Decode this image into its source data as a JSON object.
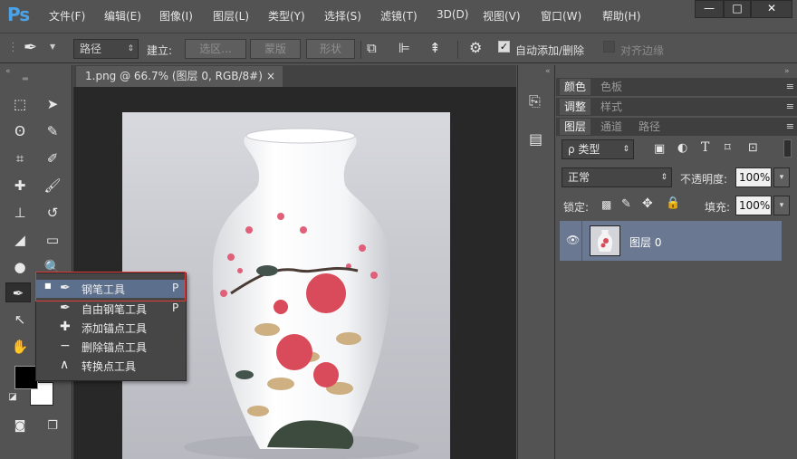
{
  "app": {
    "logo": "Ps"
  },
  "menu": [
    "文件(F)",
    "编辑(E)",
    "图像(I)",
    "图层(L)",
    "类型(Y)",
    "选择(S)",
    "滤镜(T)",
    "3D(D)",
    "视图(V)",
    "窗口(W)",
    "帮助(H)"
  ],
  "window_controls": {
    "minimize": "—",
    "maximize": "□",
    "close": "✕"
  },
  "options": {
    "mode_select": "路径",
    "make_label": "建立:",
    "selection_btn": "选区...",
    "mask_btn": "蒙版",
    "shape_btn": "形状",
    "auto_add_delete": {
      "label": "自动添加/删除",
      "checked": true
    },
    "align_edges": {
      "label": "对齐边缘",
      "checked": false
    }
  },
  "document": {
    "tab_title": "1.png @ 66.7% (图层 0, RGB/8#)",
    "tab_close": "×"
  },
  "tool_flyout": {
    "items": [
      {
        "label": "钢笔工具",
        "key": "P",
        "selected": true
      },
      {
        "label": "自由钢笔工具",
        "key": "P",
        "selected": false
      },
      {
        "label": "添加锚点工具",
        "key": "",
        "selected": false
      },
      {
        "label": "删除锚点工具",
        "key": "",
        "selected": false
      },
      {
        "label": "转换点工具",
        "key": "",
        "selected": false
      }
    ]
  },
  "panels": {
    "group1": [
      "颜色",
      "色板"
    ],
    "group2": [
      "调整",
      "样式"
    ],
    "group3": [
      "图层",
      "通道",
      "路径"
    ],
    "filter_kind": "ρ 类型",
    "blend_mode": "正常",
    "opacity_label": "不透明度:",
    "opacity_value": "100%",
    "lock_label": "锁定:",
    "fill_label": "填充:",
    "fill_value": "100%",
    "layer_name": "图层 0"
  },
  "colors": {
    "highlight_border": "#e23b3b",
    "layer_selected": "#6a7891",
    "foreground": "#000000",
    "background": "#ffffff"
  }
}
